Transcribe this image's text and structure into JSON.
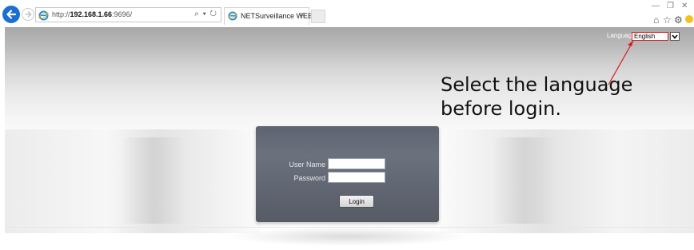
{
  "browser": {
    "url_prefix": "http://",
    "url_host": "192.168.1.66",
    "url_suffix": ":9696/",
    "url_tools": "⌕ ▾ ↻",
    "tab_title": "NETSurveillance WEB",
    "tab_close": "×",
    "win_minimize": "—",
    "win_restore": "❐",
    "win_close": "✕",
    "icons": [
      "back-arrow-icon",
      "forward-arrow-icon",
      "ie-logo-icon",
      "search-icon",
      "refresh-icon",
      "home-icon",
      "favorites-star-icon",
      "settings-gear-icon",
      "smiley-feedback-icon"
    ]
  },
  "page": {
    "language_label": "Language",
    "language_selected": "English",
    "annotation": "Select the language before login.",
    "annotation_color": "#d81b1b",
    "login": {
      "username_label": "User Name",
      "username_value": "",
      "password_label": "Password",
      "password_value": "",
      "login_button": "Login"
    }
  }
}
